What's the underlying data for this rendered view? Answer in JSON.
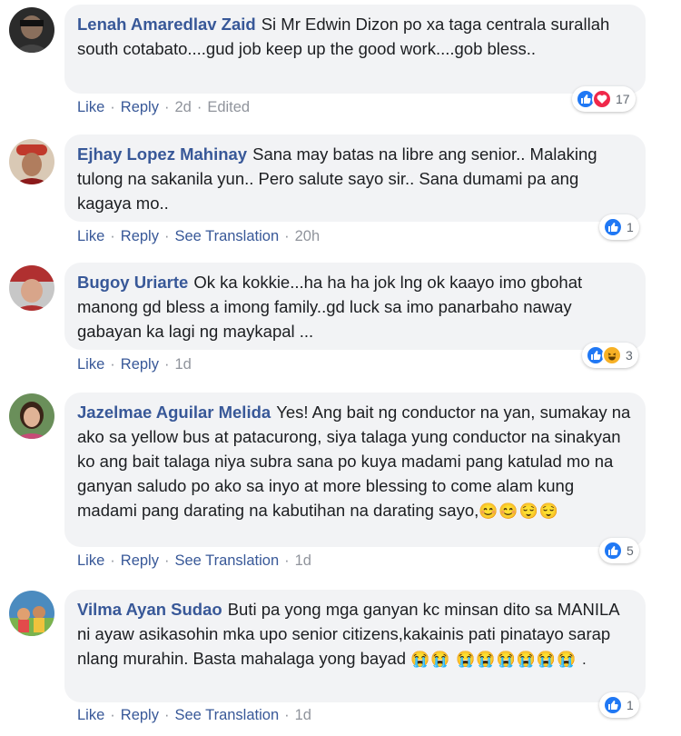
{
  "actions": {
    "like": "Like",
    "reply": "Reply",
    "see_translation": "See Translation",
    "edited": "Edited",
    "separator": "·"
  },
  "comments": [
    {
      "author": "Lenah Amaredlav Zaid",
      "text": "Si Mr Edwin Dizon po xa taga centrala surallah south cotabato....gud job keep up the good work....gob bless..",
      "time": "2d",
      "reactions": [
        "like-icon",
        "love-icon"
      ],
      "reaction_count": "17"
    },
    {
      "author": "Ejhay Lopez Mahinay",
      "text": "Sana may batas na libre ang senior.. Malaking tulong na sakanila yun.. Pero salute sayo sir.. Sana dumami pa ang kagaya mo..",
      "time": "20h",
      "reactions": [
        "like-icon"
      ],
      "reaction_count": "1"
    },
    {
      "author": "Bugoy Uriarte",
      "text": "Ok ka kokkie...ha ha ha jok lng ok kaayo imo gbohat manong gd bless a imong family..gd luck sa imo panarbaho naway gabayan ka lagi ng maykapal ...",
      "time": "1d",
      "reactions": [
        "like-icon",
        "haha-icon"
      ],
      "reaction_count": "3"
    },
    {
      "author": "Jazelmae Aguilar Melida",
      "text": "Yes! Ang bait ng conductor na yan, sumakay na ako sa yellow bus at patacurong, siya talaga yung conductor na sinakyan ko ang bait talaga niya subra sana po kuya madami pang katulad mo na ganyan saludo po ako sa inyo at more blessing to come alam kung madami pang darating na kabutihan na darating sayo,",
      "emoji": "😊😊😌😌",
      "time": "1d",
      "reactions": [
        "like-icon"
      ],
      "reaction_count": "5"
    },
    {
      "author": "Vilma Ayan Sudao",
      "text": "Buti pa yong mga ganyan kc minsan dito sa MANILA ni ayaw asikasohin mka upo senior citizens,kakainis pati pinatayo sarap nlang murahin. Basta mahalaga yong bayad",
      "emoji": "😭😭 😭😭😭😭😭😭 .",
      "time": "1d",
      "reactions": [
        "like-icon"
      ],
      "reaction_count": "1"
    }
  ]
}
